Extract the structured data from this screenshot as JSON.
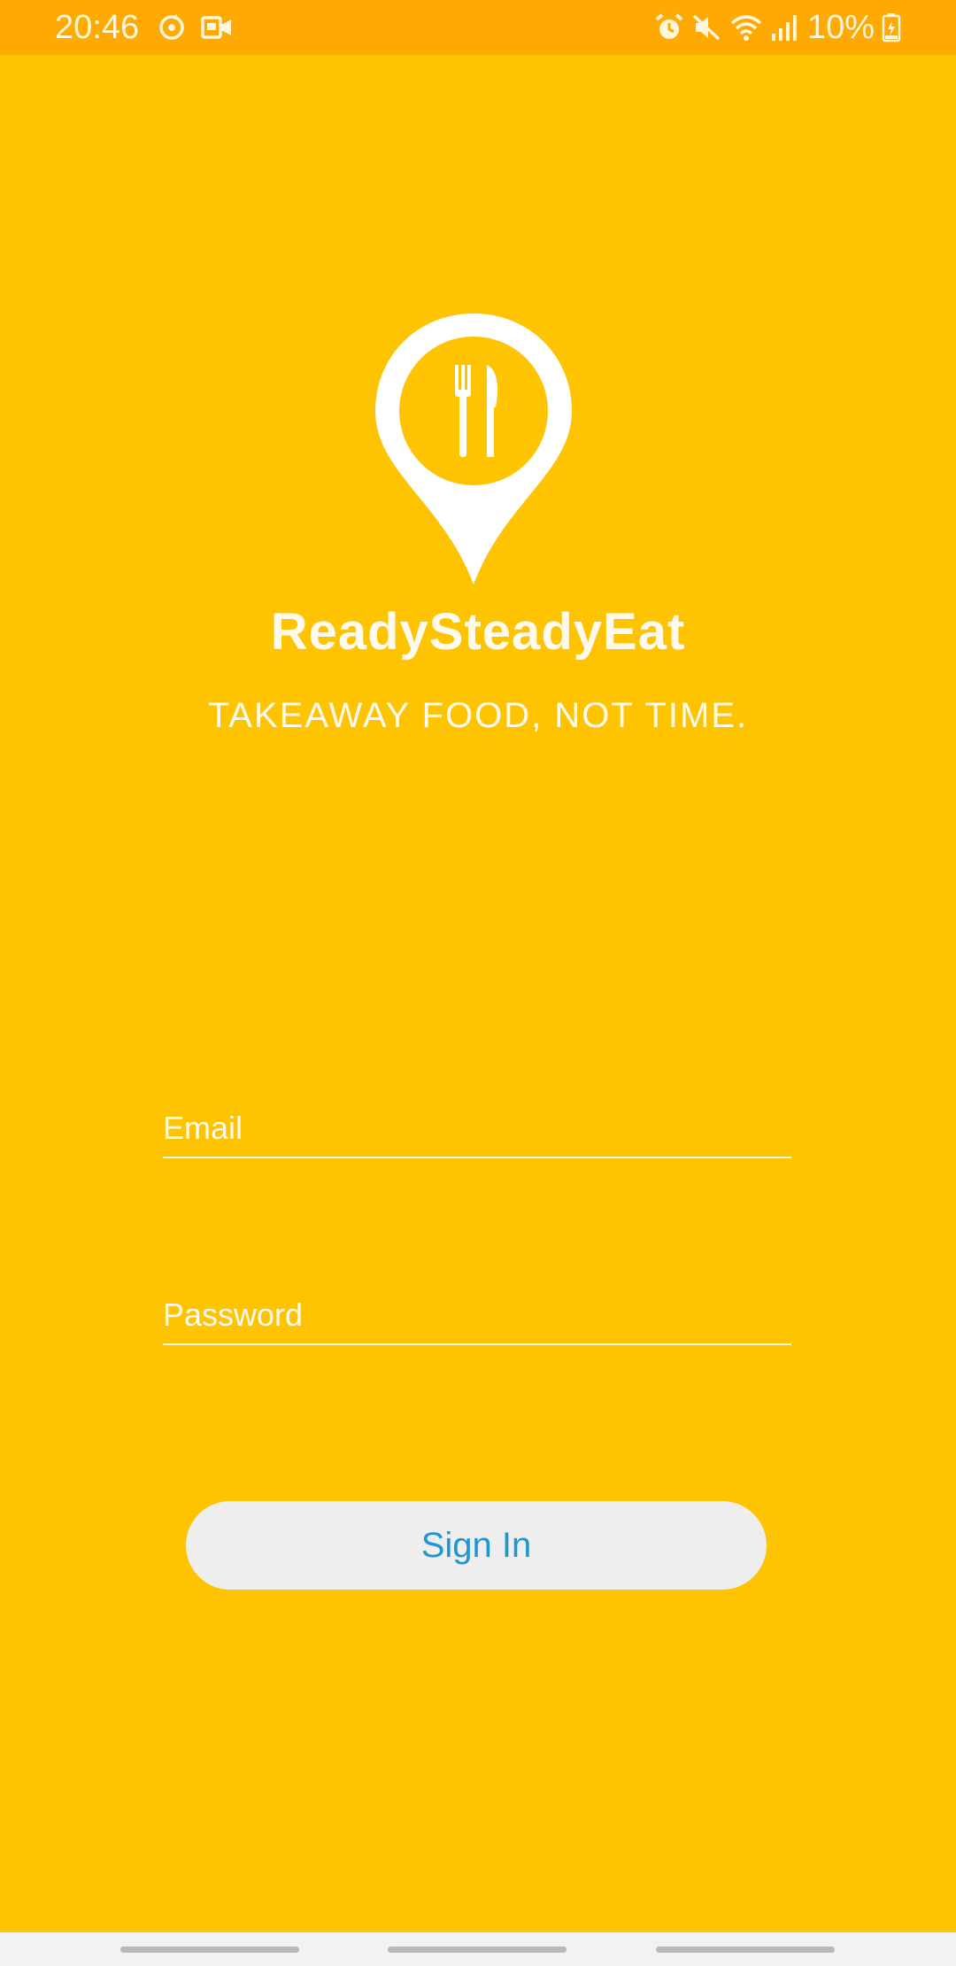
{
  "theme": {
    "background": "#FEC401",
    "status_bar_bg": "#FEAA03",
    "button_bg": "#EEEEEE",
    "button_text": "#1E96D4",
    "nav_bar_bg": "#F2F2F2"
  },
  "status_bar": {
    "time": "20:46",
    "battery_percent": "10%",
    "left_icons": [
      "sync-icon",
      "video-call-icon"
    ],
    "right_icons": [
      "alarm-icon",
      "mute-icon",
      "wifi-icon",
      "signal-icon",
      "battery-charging-icon"
    ]
  },
  "brand": {
    "logo_icon": "location-pin-cutlery-icon",
    "app_name": "ReadySteadyEat",
    "tagline": "TAKEAWAY FOOD, NOT TIME."
  },
  "form": {
    "email_placeholder": "Email",
    "email_value": "",
    "password_placeholder": "Password",
    "password_value": "",
    "sign_in_label": "Sign In"
  },
  "nav_bar": {
    "items": [
      "recent-apps",
      "home",
      "back"
    ]
  }
}
